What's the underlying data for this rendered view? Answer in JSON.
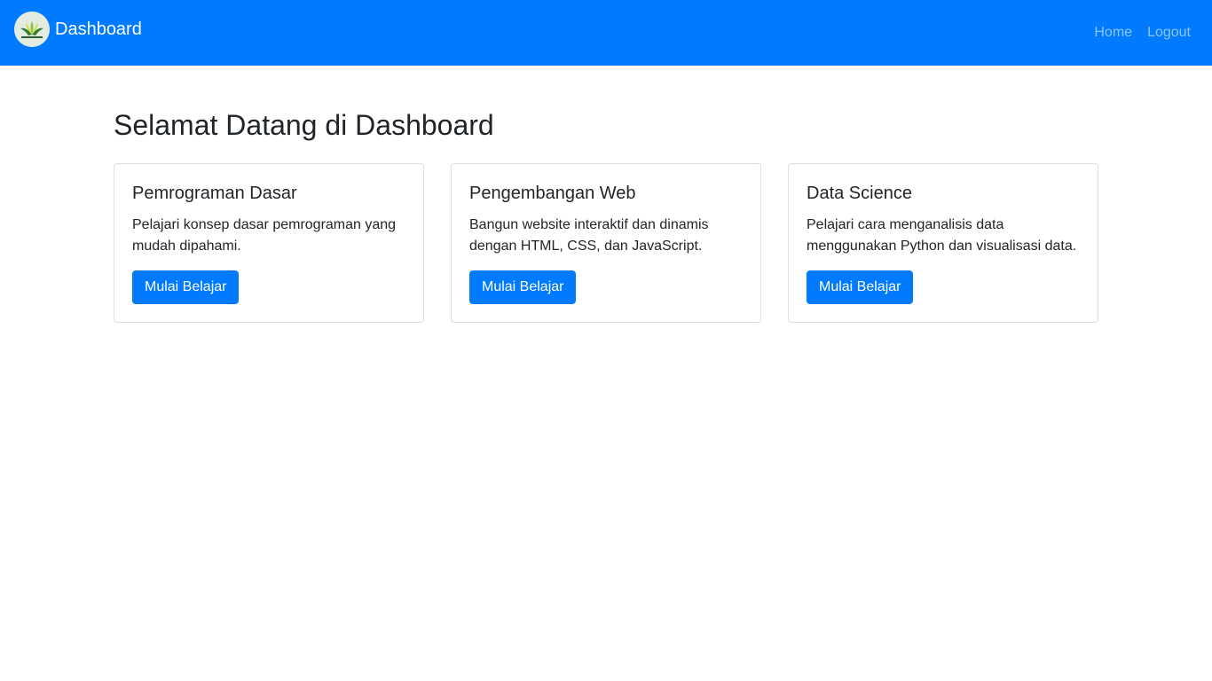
{
  "navbar": {
    "brand_label": "Dashboard",
    "logo_icon": "kelas-logo-icon",
    "links": [
      {
        "label": "Home"
      },
      {
        "label": "Logout"
      }
    ],
    "background_color": "#007bff"
  },
  "main": {
    "title": "Selamat Datang di Dashboard",
    "cards": [
      {
        "title": "Pemrograman Dasar",
        "text": "Pelajari konsep dasar pemrograman yang mudah dipahami.",
        "button_label": "Mulai Belajar"
      },
      {
        "title": "Pengembangan Web",
        "text": "Bangun website interaktif dan dinamis dengan HTML, CSS, dan JavaScript.",
        "button_label": "Mulai Belajar"
      },
      {
        "title": "Data Science",
        "text": "Pelajari cara menganalisis data menggunakan Python dan visualisasi data.",
        "button_label": "Mulai Belajar"
      }
    ]
  },
  "colors": {
    "primary": "#007bff",
    "text": "#212529"
  }
}
